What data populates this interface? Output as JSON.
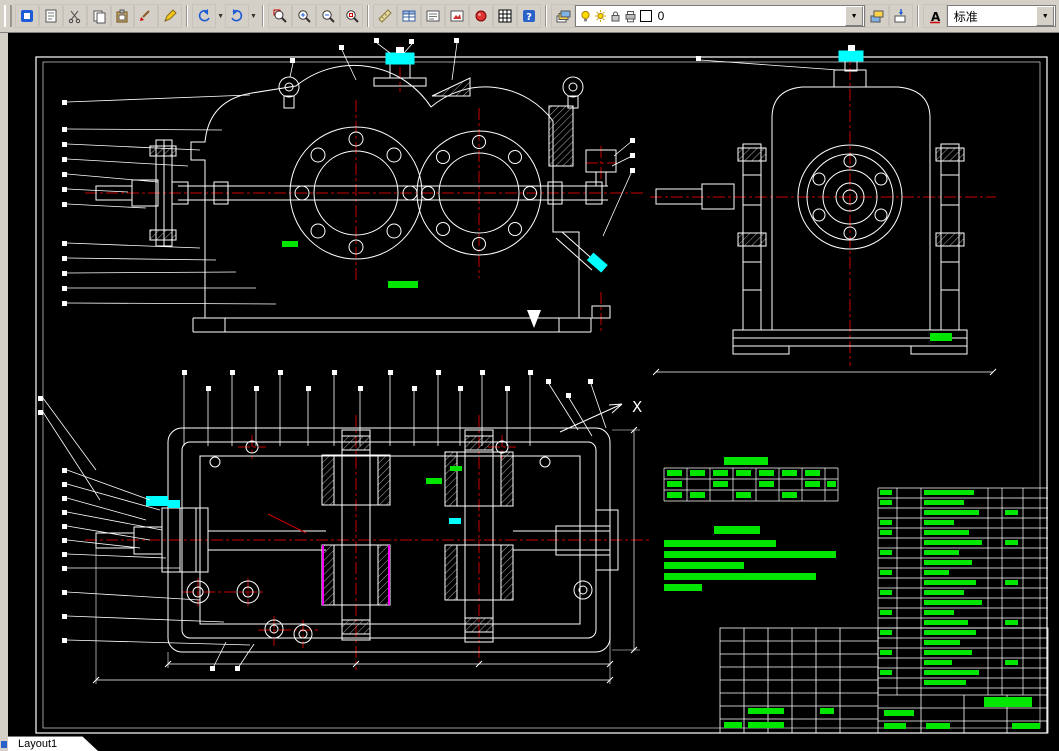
{
  "toolbar": {
    "layer_combo": {
      "value": "0"
    },
    "style_combo": {
      "value": "标准"
    },
    "dropdown_glyph": "▼",
    "icons": [
      "app-icon",
      "open-icon",
      "cut-icon",
      "copy-icon",
      "paste-icon",
      "brush-icon",
      "pencil-icon",
      "undo-icon",
      "redo-icon",
      "zoom-window-icon",
      "zoom-realtime-icon",
      "zoom-out-icon",
      "zoom-extents-icon",
      "measure-icon",
      "table-icon",
      "list-icon",
      "image-icon",
      "render-icon",
      "grid-icon",
      "help-icon",
      "layers-icon",
      "bulb-icon",
      "sun-icon",
      "lock-icon",
      "printer-icon",
      "layer-color-icon",
      "layer-states-icon",
      "text-style-icon"
    ]
  },
  "canvas": {
    "section_label": "X",
    "tab_label": "Layout1",
    "colors": {
      "background": "#000000",
      "geometry": "#ffffff",
      "centerline": "#c80000",
      "annotation_green": "#00e600",
      "highlight_cyan": "#00ffff",
      "highlight_magenta": "#ff00ff",
      "toolbar_bg": "#d4d0c8"
    }
  }
}
